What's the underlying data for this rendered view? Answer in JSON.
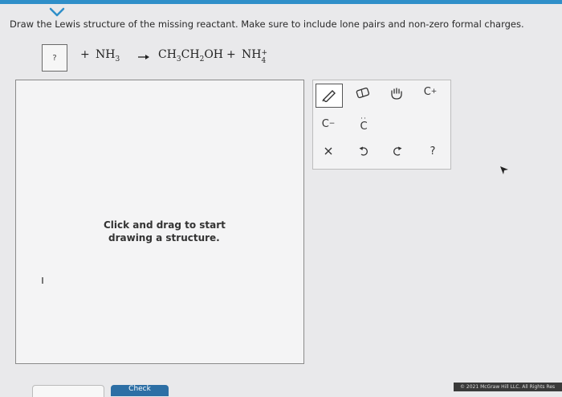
{
  "question": {
    "instruction": "Draw the Lewis structure of the missing reactant. Make sure to include lone pairs and non-zero formal charges."
  },
  "equation": {
    "missing_placeholder": "?",
    "plus1": "+",
    "reactant": {
      "base": "NH",
      "sub": "3"
    },
    "product1": {
      "a": "CH",
      "s1": "3",
      "b": "CH",
      "s2": "2",
      "c": "OH"
    },
    "plus2": "+",
    "product2": {
      "base": "NH",
      "sup": "+",
      "sub": "4"
    }
  },
  "canvas": {
    "hint_line1": "Click and drag to start",
    "hint_line2": "drawing a structure."
  },
  "palette": {
    "carbocation_base": "C",
    "carbocation_sup": "+",
    "carbanion_base": "C",
    "carbanion_sup": "−",
    "radical_label": "C",
    "help_label": "?"
  },
  "buttons": {
    "check_label": "Check"
  },
  "footer": {
    "copyright": "© 2021 McGraw Hill LLC. All Rights Res"
  },
  "colors": {
    "accent": "#2f8fc9",
    "canvas_bg": "#f4f4f5",
    "page_bg": "#e9e9eb"
  }
}
